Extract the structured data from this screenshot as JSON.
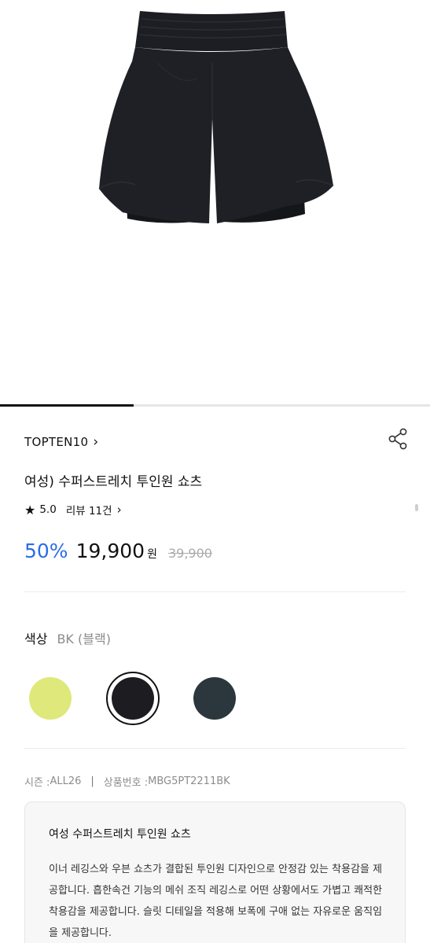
{
  "product": {
    "image_alt": "Women's super stretch two-in-one shorts, black",
    "brand": "TOPTEN10",
    "title": "여성) 수퍼스트레치 투인원 쇼츠",
    "rating": "5.0",
    "review_label": "리뷰 11건",
    "discount": "50%",
    "price": "19,900",
    "currency": "원",
    "original_price": "39,900",
    "gallery_progress": 0.31
  },
  "options": {
    "color_label": "색상",
    "color_value": "BK (블랙)",
    "swatches": [
      {
        "name": "lime",
        "color": "#dfe87a",
        "selected": false
      },
      {
        "name": "black",
        "color": "#1c1c21",
        "selected": true
      },
      {
        "name": "dark-teal",
        "color": "#2b373c",
        "selected": false
      }
    ]
  },
  "meta": {
    "season_label": "시즌 : ",
    "season_value": "ALL26",
    "sku_label": "상품번호 : ",
    "sku_value": "MBG5PT2211BK",
    "separator": "|"
  },
  "description": {
    "title": "여성 수퍼스트레치 투인원 쇼츠",
    "body": "이너 레깅스와 우븐 쇼츠가 결합된 투인원 디자인으로 안정감 있는 착용감을 제공합니다. 흡한속건 기능의 메쉬 조직 레깅스로 어떤 상황에서도 가볍고 쾌적한 착용감을 제공합니다. 슬릿 디테일을 적용해 보폭에 구애 없는 자유로운 움직임을 제공합니다."
  },
  "icons": {
    "chevron": "chevron-right-icon",
    "share": "share-icon",
    "star": "star-icon"
  }
}
